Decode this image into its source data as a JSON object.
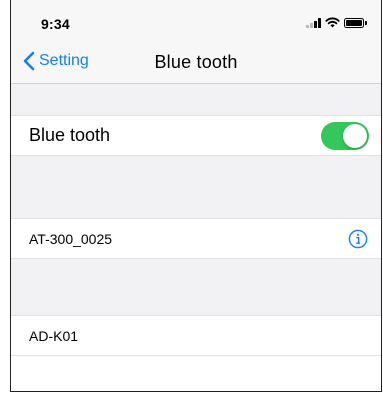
{
  "status_bar": {
    "time": "9:34",
    "signal_icon": "cellular-signal-icon",
    "wifi_icon": "wifi-icon",
    "battery_icon": "battery-icon"
  },
  "nav": {
    "back_label": "Setting",
    "back_icon": "chevron-left-icon",
    "title": "Blue tooth"
  },
  "bluetooth_row": {
    "label": "Blue tooth",
    "enabled": true
  },
  "devices": [
    {
      "name": "AT-300_0025",
      "info_icon": "info-icon"
    },
    {
      "name": "AD-K01"
    }
  ],
  "colors": {
    "accent": "#147efb",
    "toggle_on": "#34c759",
    "background": "#f2f2f4"
  }
}
